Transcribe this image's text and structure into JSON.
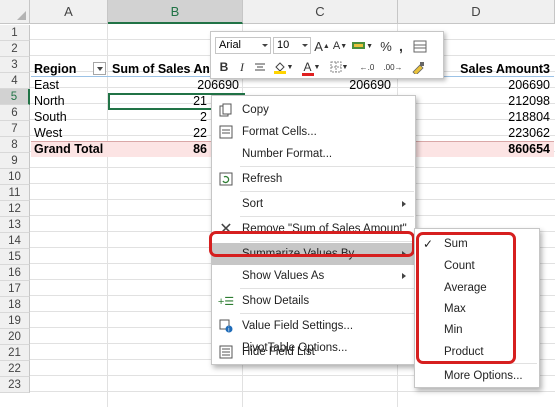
{
  "columns": [
    "A",
    "B",
    "C",
    "D"
  ],
  "rows": [
    "1",
    "2",
    "3",
    "4",
    "5",
    "6",
    "7",
    "8",
    "9",
    "10",
    "11",
    "12",
    "13",
    "14",
    "15",
    "16",
    "17",
    "18",
    "19",
    "20",
    "21",
    "22",
    "23"
  ],
  "pivot": {
    "header": {
      "region": "Region",
      "sum_sales": "Sum of Sales Am",
      "sum_sales3": "Sales Amount3"
    },
    "data_rows": [
      {
        "region": "East",
        "b": "206690",
        "c": "206690",
        "d": "206690"
      },
      {
        "region": "North",
        "b": "21",
        "c": "",
        "d": "212098"
      },
      {
        "region": "South",
        "b": "2",
        "c": "",
        "d": "218804"
      },
      {
        "region": "West",
        "b": "22",
        "c": "",
        "d": "223062"
      }
    ],
    "grand_total": {
      "label": "Grand Total",
      "b": "86",
      "d": "860654"
    }
  },
  "mini_toolbar": {
    "font_name": "Arial",
    "font_size": "10",
    "grow_font": "A",
    "shrink_font": "A",
    "percent": "%",
    "comma": ",",
    "bold": "B",
    "italic": "I",
    "font_color": "A",
    "inc_decimal": "←.0",
    "dec_decimal": ".00→"
  },
  "context_menu": {
    "items": [
      {
        "label": "Copy",
        "icon": "copy-icon"
      },
      {
        "label": "Format Cells...",
        "icon": "format-cells-icon"
      },
      {
        "label": "Number Format...",
        "icon": ""
      },
      {
        "label": "Refresh",
        "icon": "refresh-icon"
      },
      {
        "label": "Sort",
        "icon": ""
      },
      {
        "label": "Remove \"Sum of Sales Amount\"",
        "icon": "remove-x-icon"
      },
      {
        "label": "Summarize Values By",
        "icon": ""
      },
      {
        "label": "Show Values As",
        "icon": ""
      },
      {
        "label": "Show Details",
        "icon": "show-details-icon"
      },
      {
        "label": "Value Field Settings...",
        "icon": "value-field-settings-icon"
      },
      {
        "label": "PivotTable Options...",
        "icon": ""
      },
      {
        "label": "Hide Field List",
        "icon": "field-list-icon"
      }
    ]
  },
  "summarize_submenu": {
    "items": [
      {
        "label": "Sum",
        "checked": true
      },
      {
        "label": "Count",
        "checked": false
      },
      {
        "label": "Average",
        "checked": false
      },
      {
        "label": "Max",
        "checked": false
      },
      {
        "label": "Min",
        "checked": false
      },
      {
        "label": "Product",
        "checked": false
      },
      {
        "label": "More Options...",
        "checked": false
      }
    ]
  },
  "colors": {
    "accent_green": "#217346",
    "highlight_red": "#d61f1f",
    "grand_total_fill": "#fce4e4"
  }
}
